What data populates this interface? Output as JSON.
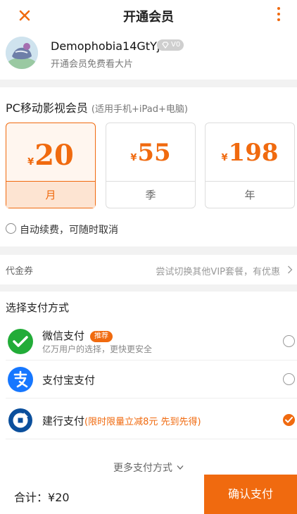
{
  "header": {
    "title": "开通会员"
  },
  "profile": {
    "username": "Demophobia14GtYj",
    "vip_level": "V0",
    "subtitle": "开通会员免费看大片"
  },
  "plans": {
    "title": "PC移动影视会员",
    "note": "(适用手机+iPad+电脑)",
    "currency": "¥",
    "items": [
      {
        "price": "20",
        "label": "月",
        "selected": true
      },
      {
        "price": "55",
        "label": "季",
        "selected": false
      },
      {
        "price": "198",
        "label": "年",
        "selected": false
      }
    ],
    "auto_renew_label": "自动续费，可随时取消",
    "auto_renew_checked": false
  },
  "voucher": {
    "label": "代金券",
    "hint": "尝试切换其他VIP套餐，有优惠"
  },
  "payment": {
    "title": "选择支付方式",
    "methods": [
      {
        "name": "微信支付",
        "tag": "推荐",
        "subtitle": "亿万用户的选择，更快更安全",
        "icon": "wechat-pay-icon",
        "checked": false
      },
      {
        "name": "支付宝支付",
        "icon": "alipay-icon",
        "checked": false
      },
      {
        "name": "建行支付",
        "promo": "(限时限量立减8元 先到先得)",
        "icon": "ccb-icon",
        "checked": true
      }
    ],
    "more_label": "更多支付方式"
  },
  "footer": {
    "total_label": "合计：",
    "total_amount": "¥20",
    "confirm_label": "确认支付"
  },
  "colors": {
    "accent": "#f06a0f",
    "wechat": "#22ac38",
    "alipay": "#1677ff",
    "ccb": "#0b4f9c"
  }
}
